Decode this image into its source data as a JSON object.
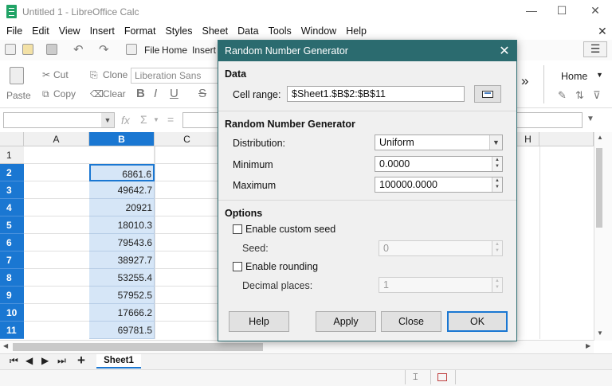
{
  "window": {
    "title": "Untitled 1 - LibreOffice Calc",
    "minimize": "—",
    "maximize": "☐",
    "close": "✕"
  },
  "menubar": {
    "items": [
      "File",
      "Edit",
      "View",
      "Insert",
      "Format",
      "Styles",
      "Sheet",
      "Data",
      "Tools",
      "Window",
      "Help"
    ],
    "doc_close": "✕"
  },
  "toolbar": {
    "tab_file": "File",
    "tab_home": "Home",
    "tab_insert": "Insert",
    "paste": "Paste",
    "cut": "Cut",
    "copy": "Copy",
    "clone": "Clone",
    "clear": "Clear",
    "font_name": "Liberation Sans",
    "bold": "B",
    "italic": "I",
    "underline": "U",
    "strike": "S",
    "more": "»",
    "home_right": "Home",
    "sidebar_menu": "☰"
  },
  "formula_bar": {
    "fx": "fx",
    "sum": "Σ",
    "equals": "="
  },
  "grid": {
    "columns": [
      "A",
      "B",
      "C",
      "H"
    ],
    "rows": [
      "1",
      "2",
      "3",
      "4",
      "5",
      "6",
      "7",
      "8",
      "9",
      "10",
      "11"
    ],
    "b_values": [
      "",
      "6861.6",
      "49642.7",
      "20921",
      "18010.3",
      "79543.6",
      "38927.7",
      "53255.4",
      "57952.5",
      "17666.2",
      "69781.5"
    ]
  },
  "sheets": {
    "active_tab": "Sheet1",
    "add": "+"
  },
  "dialog": {
    "title": "Random Number Generator",
    "close": "✕",
    "section_data": "Data",
    "cell_range_label": "Cell range:",
    "cell_range_value": "$Sheet1.$B$2:$B$11",
    "section_rng": "Random Number Generator",
    "distribution_label": "Distribution:",
    "distribution_value": "Uniform",
    "minimum_label": "Minimum",
    "minimum_value": "0.0000",
    "maximum_label": "Maximum",
    "maximum_value": "100000.0000",
    "section_options": "Options",
    "enable_seed_label": "Enable custom seed",
    "seed_label": "Seed:",
    "seed_value": "0",
    "enable_rounding_label": "Enable rounding",
    "decimal_places_label": "Decimal places:",
    "decimal_places_value": "1",
    "help": "Help",
    "apply": "Apply",
    "close_btn": "Close",
    "ok": "OK"
  }
}
